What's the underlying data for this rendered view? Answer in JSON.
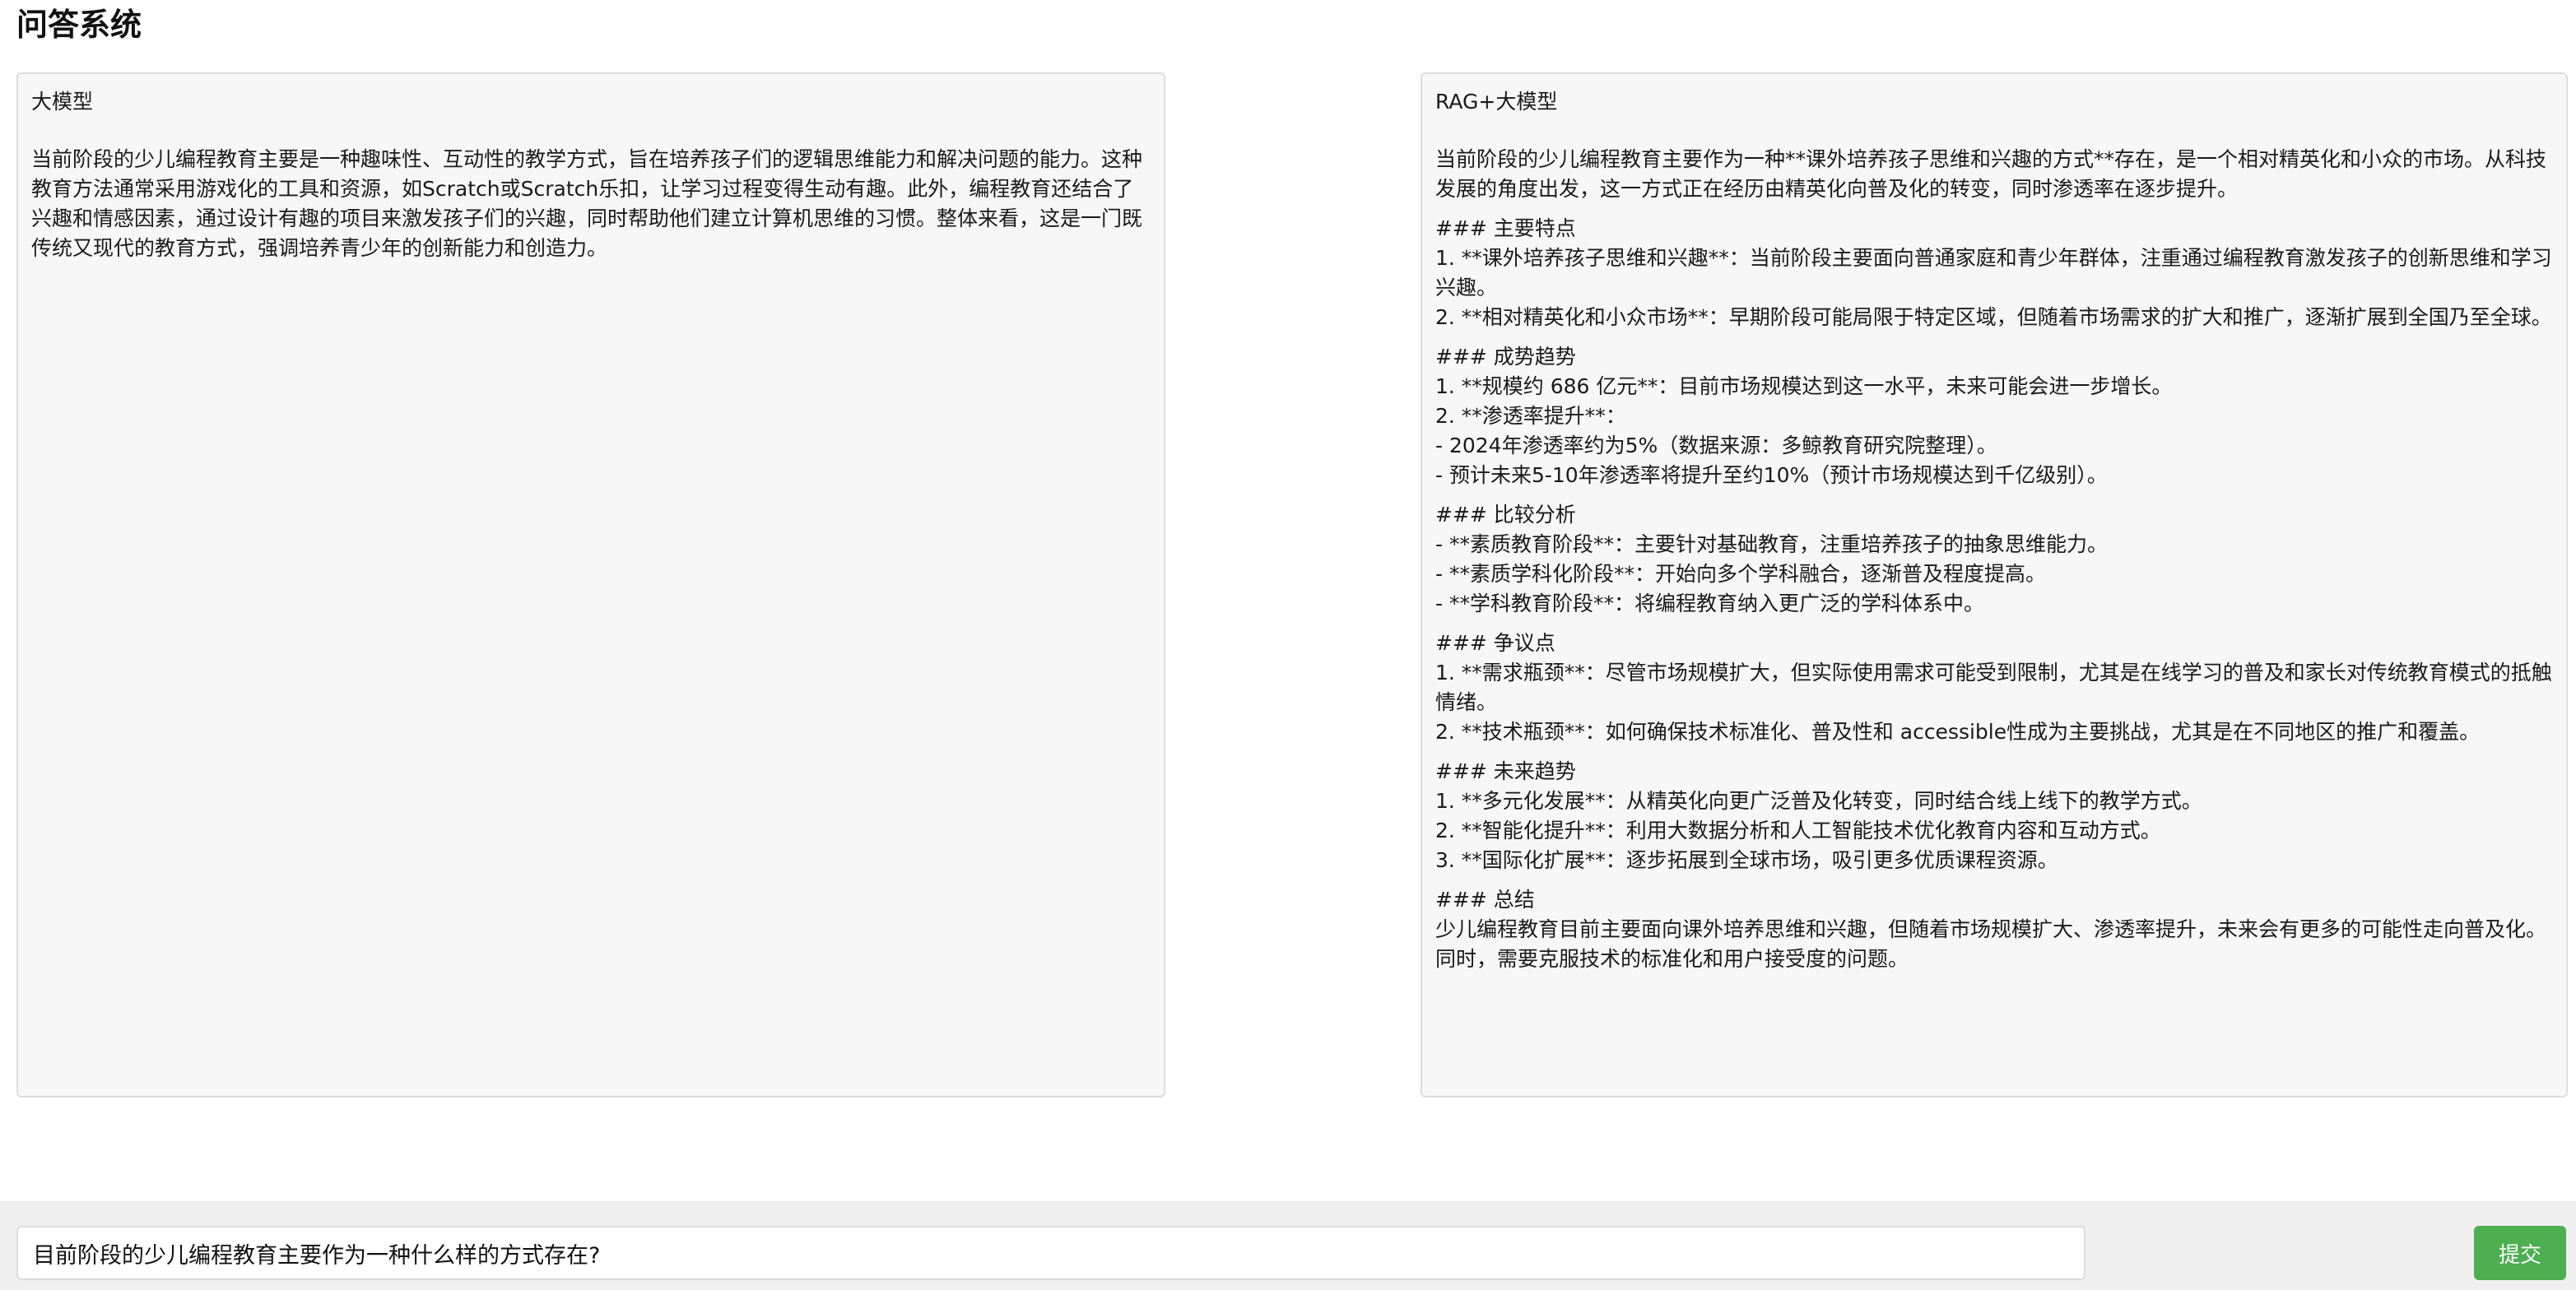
{
  "header": {
    "title": "问答系统"
  },
  "left_panel": {
    "title": "大模型",
    "paragraphs": [
      "当前阶段的少儿编程教育主要是一种趣味性、互动性的教学方式，旨在培养孩子们的逻辑思维能力和解决问题的能力。这种教育方法通常采用游戏化的工具和资源，如Scratch或Scratch乐扣，让学习过程变得生动有趣。此外，编程教育还结合了兴趣和情感因素，通过设计有趣的项目来激发孩子们的兴趣，同时帮助他们建立计算机思维的习惯。整体来看，这是一门既传统又现代的教育方式，强调培养青少年的创新能力和创造力。"
    ]
  },
  "right_panel": {
    "title": "RAG+大模型",
    "paragraphs": [
      "当前阶段的少儿编程教育主要作为一种**课外培养孩子思维和兴趣的方式**存在，是一个相对精英化和小众的市场。从科技发展的角度出发，这一方式正在经历由精英化向普及化的转变，同时渗透率在逐步提升。",
      "### 主要特点\n1. **课外培养孩子思维和兴趣**：当前阶段主要面向普通家庭和青少年群体，注重通过编程教育激发孩子的创新思维和学习兴趣。\n2. **相对精英化和小众市场**：早期阶段可能局限于特定区域，但随着市场需求的扩大和推广，逐渐扩展到全国乃至全球。",
      "### 成势趋势\n1. **规模约 686 亿元**：目前市场规模达到这一水平，未来可能会进一步增长。\n2. **渗透率提升**：\n- 2024年渗透率约为5%（数据来源：多鲸教育研究院整理）。\n- 预计未来5-10年渗透率将提升至约10%（预计市场规模达到千亿级别）。",
      "### 比较分析\n- **素质教育阶段**：主要针对基础教育，注重培养孩子的抽象思维能力。\n- **素质学科化阶段**：开始向多个学科融合，逐渐普及程度提高。\n- **学科教育阶段**：将编程教育纳入更广泛的学科体系中。",
      "### 争议点\n1. **需求瓶颈**：尽管市场规模扩大，但实际使用需求可能受到限制，尤其是在线学习的普及和家长对传统教育模式的抵触情绪。\n2. **技术瓶颈**：如何确保技术标准化、普及性和 accessible性成为主要挑战，尤其是在不同地区的推广和覆盖。",
      "### 未来趋势\n1. **多元化发展**：从精英化向更广泛普及化转变，同时结合线上线下的教学方式。\n2. **智能化提升**：利用大数据分析和人工智能技术优化教育内容和互动方式。\n3. **国际化扩展**：逐步拓展到全球市场，吸引更多优质课程资源。",
      "### 总结\n少儿编程教育目前主要面向课外培养思维和兴趣，但随着市场规模扩大、渗透率提升，未来会有更多的可能性走向普及化。同时，需要克服技术的标准化和用户接受度的问题。"
    ]
  },
  "query": {
    "value": "目前阶段的少儿编程教育主要作为一种什么样的方式存在?",
    "submit_label": "提交"
  },
  "colors": {
    "submit_button": "#4caf50",
    "panel_background": "#f7f7f7",
    "bottom_bar": "#f0f0f0"
  }
}
